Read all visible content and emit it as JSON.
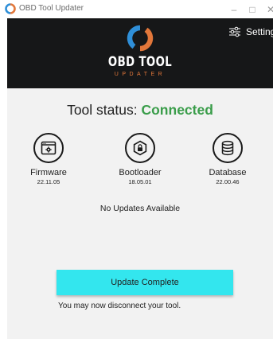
{
  "window": {
    "title": "OBD Tool Updater",
    "minimize_glyph": "–",
    "maximize_glyph": "□",
    "close_glyph": "✕"
  },
  "header": {
    "logo_title": "OBD TOOL",
    "logo_subtitle": "UPDATER",
    "settings_label": "Settings",
    "settings_icon": "sliders-icon"
  },
  "status": {
    "label": "Tool status:",
    "value": "Connected",
    "value_color": "#3a9d4a"
  },
  "components": [
    {
      "name": "Firmware",
      "version": "22.11.05",
      "icon": "firmware-window-gear-icon"
    },
    {
      "name": "Bootloader",
      "version": "18.05.01",
      "icon": "lock-hexagon-icon"
    },
    {
      "name": "Database",
      "version": "22.00.46",
      "icon": "database-icon"
    }
  ],
  "updates_message": "No Updates Available",
  "update_button": {
    "label": "Update Complete",
    "color": "#33e6ee"
  },
  "footer_note": "You may now disconnect your tool.",
  "colors": {
    "header_bg": "#161718",
    "logo_blue": "#2f8fd8",
    "logo_orange": "#e2773a",
    "content_bg": "#f2f2f2"
  }
}
